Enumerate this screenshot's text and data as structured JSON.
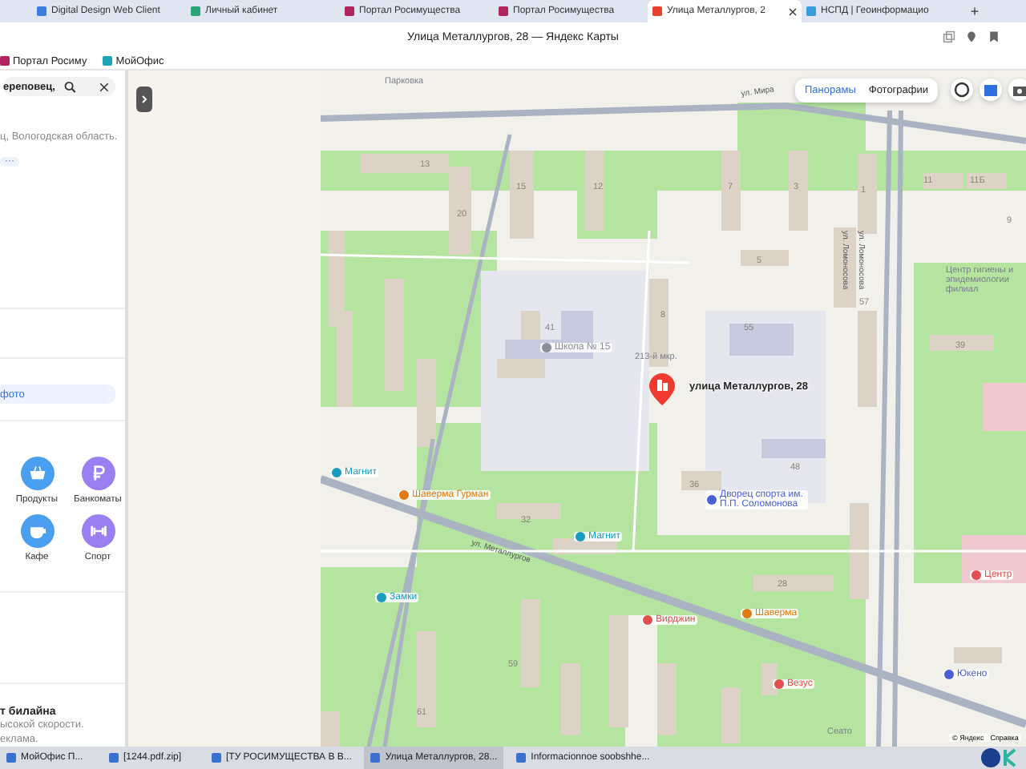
{
  "browser": {
    "tabs": [
      {
        "title": "Digital Design Web Client",
        "selected": false,
        "color": "#3b7de0"
      },
      {
        "title": "Личный кабинет",
        "selected": false,
        "color": "#2aa57a"
      },
      {
        "title": "Портал Росимущества",
        "selected": false,
        "color": "#b0245e"
      },
      {
        "title": "Портал Росимущества",
        "selected": false,
        "color": "#b0245e"
      },
      {
        "title": "Улица Металлургов, 2",
        "selected": true,
        "color": "#e8402f"
      },
      {
        "title": "НСПД | Геоинформацио",
        "selected": false,
        "color": "#3a9be0"
      }
    ],
    "new_tab": "+"
  },
  "window": {
    "title": "Улица Металлургов, 28 — Яндекс Карты"
  },
  "bookmarks": [
    {
      "label": "Портал Росиму",
      "color": "#b0245e"
    },
    {
      "label": "МойОфис",
      "color": "#1fa3b8"
    }
  ],
  "sidebar": {
    "search": {
      "value": "ереповец,"
    },
    "address": "ц, Вологодская область.",
    "more": "···",
    "photo_button": "фото",
    "categories": [
      {
        "label": "Продукты",
        "kind": "basket",
        "color": "#4a9ff0"
      },
      {
        "label": "Банкоматы",
        "kind": "ruble",
        "color": "#9a7ff0"
      },
      {
        "label": "Кафе",
        "kind": "cup",
        "color": "#4a9ff0"
      },
      {
        "label": "Спорт",
        "kind": "dumbbell",
        "color": "#9a7ff0"
      }
    ],
    "ad": {
      "title": "т билайна",
      "lines": [
        "ысокой скорости.",
        "еклама."
      ]
    }
  },
  "map": {
    "controls": [
      {
        "label": "Панорамы",
        "selected": true
      },
      {
        "label": "Фотографии",
        "selected": false
      }
    ],
    "selected_place": "улица Металлургов, 28",
    "labels": [
      {
        "text": "Парковка",
        "kind": "area"
      },
      {
        "text": "ул. Мира",
        "kind": "street"
      },
      {
        "text": "13",
        "kind": "house"
      },
      {
        "text": "11",
        "kind": "house"
      },
      {
        "text": "11Б",
        "kind": "house"
      },
      {
        "text": "15",
        "kind": "house"
      },
      {
        "text": "12",
        "kind": "house"
      },
      {
        "text": "7",
        "kind": "house"
      },
      {
        "text": "3",
        "kind": "house"
      },
      {
        "text": "1",
        "kind": "house"
      },
      {
        "text": "20",
        "kind": "house"
      },
      {
        "text": "9",
        "kind": "house"
      },
      {
        "text": "ул. Ломоносова",
        "kind": "street"
      },
      {
        "text": "ул. Ломоносова",
        "kind": "street"
      },
      {
        "text": "5",
        "kind": "house"
      },
      {
        "text": "Центр гигиены и эпидемиологии филиал",
        "kind": "area"
      },
      {
        "text": "57",
        "kind": "house"
      },
      {
        "text": "8",
        "kind": "house"
      },
      {
        "text": "41",
        "kind": "house"
      },
      {
        "text": "55",
        "kind": "house"
      },
      {
        "text": "39",
        "kind": "house"
      },
      {
        "text": "Школа № 15",
        "kind": "poi",
        "color": "#8a8f99"
      },
      {
        "text": "213-й мкр.",
        "kind": "area"
      },
      {
        "text": "48",
        "kind": "house"
      },
      {
        "text": "Магнит",
        "kind": "poi",
        "color": "#1a9cc0"
      },
      {
        "text": "36",
        "kind": "house"
      },
      {
        "text": "Шаверма Гурман",
        "kind": "poi",
        "color": "#e07a14"
      },
      {
        "text": "Дворец спорта им. П.П. Соломонова",
        "kind": "poi",
        "color": "#4a5fd6"
      },
      {
        "text": "32",
        "kind": "house"
      },
      {
        "text": "Магнит",
        "kind": "poi",
        "color": "#1a9cc0"
      },
      {
        "text": "ул. Металлургов",
        "kind": "street"
      },
      {
        "text": "Центр",
        "kind": "poi",
        "color": "#e05050"
      },
      {
        "text": "28",
        "kind": "house"
      },
      {
        "text": "Замки",
        "kind": "poi",
        "color": "#1a9cc0"
      },
      {
        "text": "Вирджин",
        "kind": "poi",
        "color": "#e05050"
      },
      {
        "text": "Шаверма",
        "kind": "poi",
        "color": "#e07a14"
      },
      {
        "text": "59",
        "kind": "house"
      },
      {
        "text": "Юкено",
        "kind": "poi",
        "color": "#4a5fd6"
      },
      {
        "text": "Везус",
        "kind": "poi",
        "color": "#e05050"
      },
      {
        "text": "61",
        "kind": "house"
      },
      {
        "text": "Сеато",
        "kind": "area"
      }
    ],
    "footer": [
      "© Яндекс",
      "Справка"
    ]
  },
  "taskbar": {
    "items": [
      {
        "label": "МойОфис П...",
        "selected": false
      },
      {
        "label": "[1244.pdf.zip]",
        "selected": false
      },
      {
        "label": "[ТУ РОСИМУЩЕСТВА В В...",
        "selected": false
      },
      {
        "label": "Улица Металлургов, 28...",
        "selected": true
      },
      {
        "label": "Informacionnoe soobshhe...",
        "selected": false
      }
    ]
  }
}
